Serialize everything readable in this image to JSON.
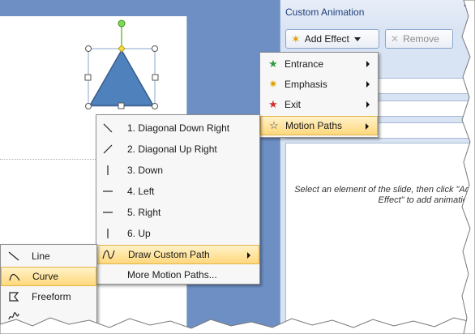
{
  "pane": {
    "title": "Custom Animation",
    "add_effect": "Add Effect",
    "remove": "Remove",
    "hint": "Select an element of the slide, then click \"Add Effect\" to add animation."
  },
  "add_effect_menu": [
    {
      "label": "Entrance",
      "icon": "entrance-star-icon"
    },
    {
      "label": "Emphasis",
      "icon": "emphasis-star-icon"
    },
    {
      "label": "Exit",
      "icon": "exit-star-icon"
    },
    {
      "label": "Motion Paths",
      "icon": "motion-paths-star-icon",
      "highlighted": true
    }
  ],
  "motion_paths_menu": [
    {
      "label": "1. Diagonal Down Right",
      "icon": "diagonal-down-right-icon"
    },
    {
      "label": "2. Diagonal Up Right",
      "icon": "diagonal-up-right-icon"
    },
    {
      "label": "3. Down",
      "icon": "down-line-icon"
    },
    {
      "label": "4. Left",
      "icon": "left-line-icon"
    },
    {
      "label": "5. Right",
      "icon": "right-line-icon"
    },
    {
      "label": "6. Up",
      "icon": "up-line-icon"
    },
    {
      "label": "Draw Custom Path",
      "icon": "curve-path-icon",
      "highlighted": true
    },
    {
      "label": "More Motion Paths..."
    }
  ],
  "draw_custom_path_menu": [
    {
      "label": "Line",
      "icon": "line-tool-icon"
    },
    {
      "label": "Curve",
      "icon": "curve-tool-icon",
      "highlighted": true
    },
    {
      "label": "Freeform",
      "icon": "freeform-tool-icon"
    },
    {
      "label": "",
      "icon": "scribble-tool-icon"
    }
  ],
  "colors": {
    "highlight": "#ffd87c",
    "shape_fill": "#4f81bd",
    "pane_title": "#1e3f7a"
  }
}
